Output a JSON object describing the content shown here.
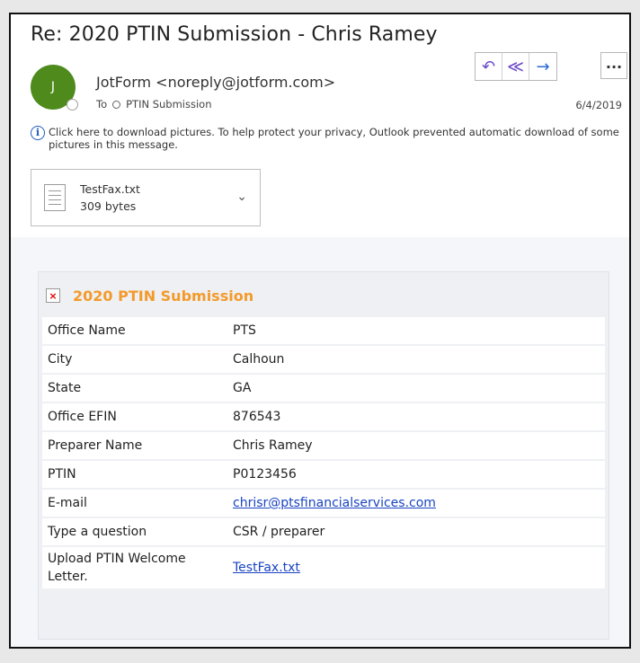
{
  "email": {
    "subject": "Re: 2020 PTIN Submission - Chris Ramey",
    "avatar_initial": "J",
    "sender": "JotForm <noreply@jotform.com>",
    "to_label": "To",
    "recipient": "PTIN Submission",
    "date": "6/4/2019",
    "info_message": "Click here to download pictures. To help protect your privacy, Outlook prevented automatic download of some pictures in this message.",
    "actions": {
      "reply": "↶",
      "reply_all": "≪",
      "forward": "→",
      "more": "..."
    },
    "attachment": {
      "name": "TestFax.txt",
      "size": "309 bytes"
    }
  },
  "form": {
    "title": "2020 PTIN Submission",
    "rows": [
      {
        "label": "Office Name",
        "value": "PTS"
      },
      {
        "label": "City",
        "value": "Calhoun"
      },
      {
        "label": "State",
        "value": "GA"
      },
      {
        "label": "Office EFIN",
        "value": "876543"
      },
      {
        "label": "Preparer Name",
        "value": "Chris Ramey"
      },
      {
        "label": "PTIN",
        "value": "P0123456"
      },
      {
        "label": "E-mail",
        "value": "chrisr@ptsfinancialservices.com"
      },
      {
        "label": "Type a question",
        "value": "CSR / preparer"
      },
      {
        "label": "Upload PTIN Welcome Letter.",
        "value": "TestFax.txt"
      }
    ]
  },
  "colors": {
    "avatar": "#4e8b1c",
    "form_title": "#f39a2b",
    "link": "#1a44c2",
    "reply_icons": "#6b49c7"
  }
}
